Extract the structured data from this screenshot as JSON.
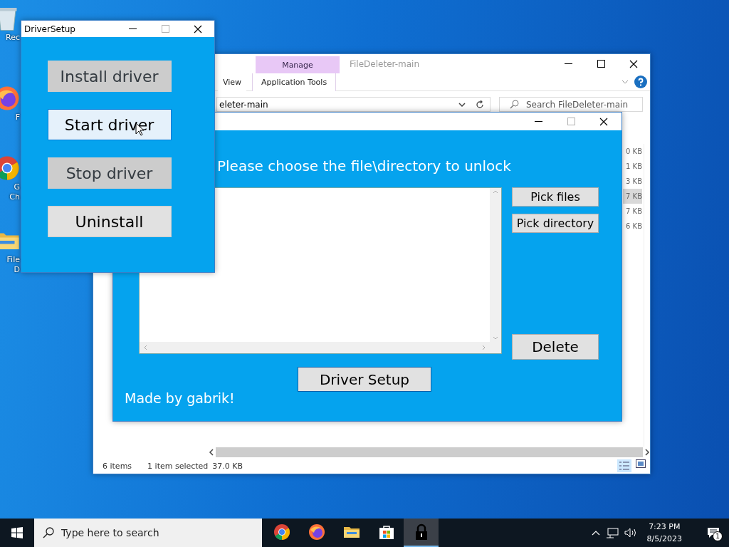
{
  "desktop_icons": [
    {
      "kind": "bin",
      "label": "Rec"
    },
    {
      "kind": "firefox",
      "label": "F"
    },
    {
      "kind": "chrome",
      "label": "G Ch"
    },
    {
      "kind": "folder",
      "label": "FileD"
    }
  ],
  "explorer": {
    "title": "FileDeleter-main",
    "contextual_tab": "Manage",
    "ribbon_tabs": [
      {
        "label": "View",
        "selected": false
      },
      {
        "label": "Application Tools",
        "selected": true
      }
    ],
    "address": "eleter-main",
    "search": {
      "placeholder": "Search FileDeleter-main"
    },
    "sizes": [
      {
        "text": "0 KB",
        "selected": false
      },
      {
        "text": "1 KB",
        "selected": false
      },
      {
        "text": "3 KB",
        "selected": false
      },
      {
        "text": "7 KB",
        "selected": true
      },
      {
        "text": "7 KB",
        "selected": false
      },
      {
        "text": "6 KB",
        "selected": false
      }
    ],
    "status_bar": {
      "count": "6 items",
      "selection": "1 item selected",
      "size": "37.0 KB"
    }
  },
  "file_deleter": {
    "heading": "Please choose the file\\directory to unlock",
    "side_buttons": [
      "Pick files",
      "Pick directory"
    ],
    "delete_button": "Delete",
    "setup_button": "Driver Setup",
    "footer": "Made by gabrik!"
  },
  "driver_setup": {
    "title": "DriverSetup",
    "buttons": [
      {
        "label": "Install driver",
        "disabled": true,
        "hovered": false
      },
      {
        "label": "Start driver",
        "disabled": false,
        "hovered": true
      },
      {
        "label": "Stop driver",
        "disabled": true,
        "hovered": false
      },
      {
        "label": "Uninstall",
        "disabled": false,
        "hovered": false
      }
    ]
  },
  "taskbar": {
    "search": {
      "placeholder": "Type here to search"
    },
    "apps": [
      {
        "kind": "chrome",
        "selected": false
      },
      {
        "kind": "firefox",
        "selected": false
      },
      {
        "kind": "folder",
        "selected": false
      },
      {
        "kind": "store",
        "selected": false
      },
      {
        "kind": "lock",
        "selected": true
      }
    ],
    "time": "7:23 PM",
    "date": "8/5/2023",
    "notifications": "1"
  }
}
